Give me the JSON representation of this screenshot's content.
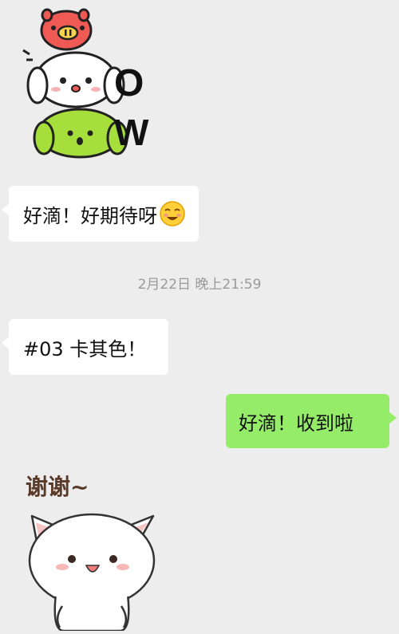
{
  "messages": [
    {
      "side": "left",
      "type": "sticker",
      "sticker": "pig-puppy-wow-sticker",
      "text": "OW"
    },
    {
      "side": "left",
      "type": "text",
      "text": "好滴！好期待呀",
      "emoji": "smiling-face-emoji"
    },
    {
      "type": "timestamp",
      "text": "2月22日 晚上21:59"
    },
    {
      "side": "left",
      "type": "text",
      "text": "#03 卡其色！"
    },
    {
      "side": "right",
      "type": "text",
      "text": "好滴！收到啦"
    },
    {
      "side": "left",
      "type": "sticker",
      "sticker": "thank-you-cat-sticker",
      "text": "谢谢~"
    }
  ],
  "colors": {
    "background": "#ededed",
    "incoming_bubble": "#ffffff",
    "outgoing_bubble": "#95ec69",
    "timestamp": "#9a9a9a"
  }
}
